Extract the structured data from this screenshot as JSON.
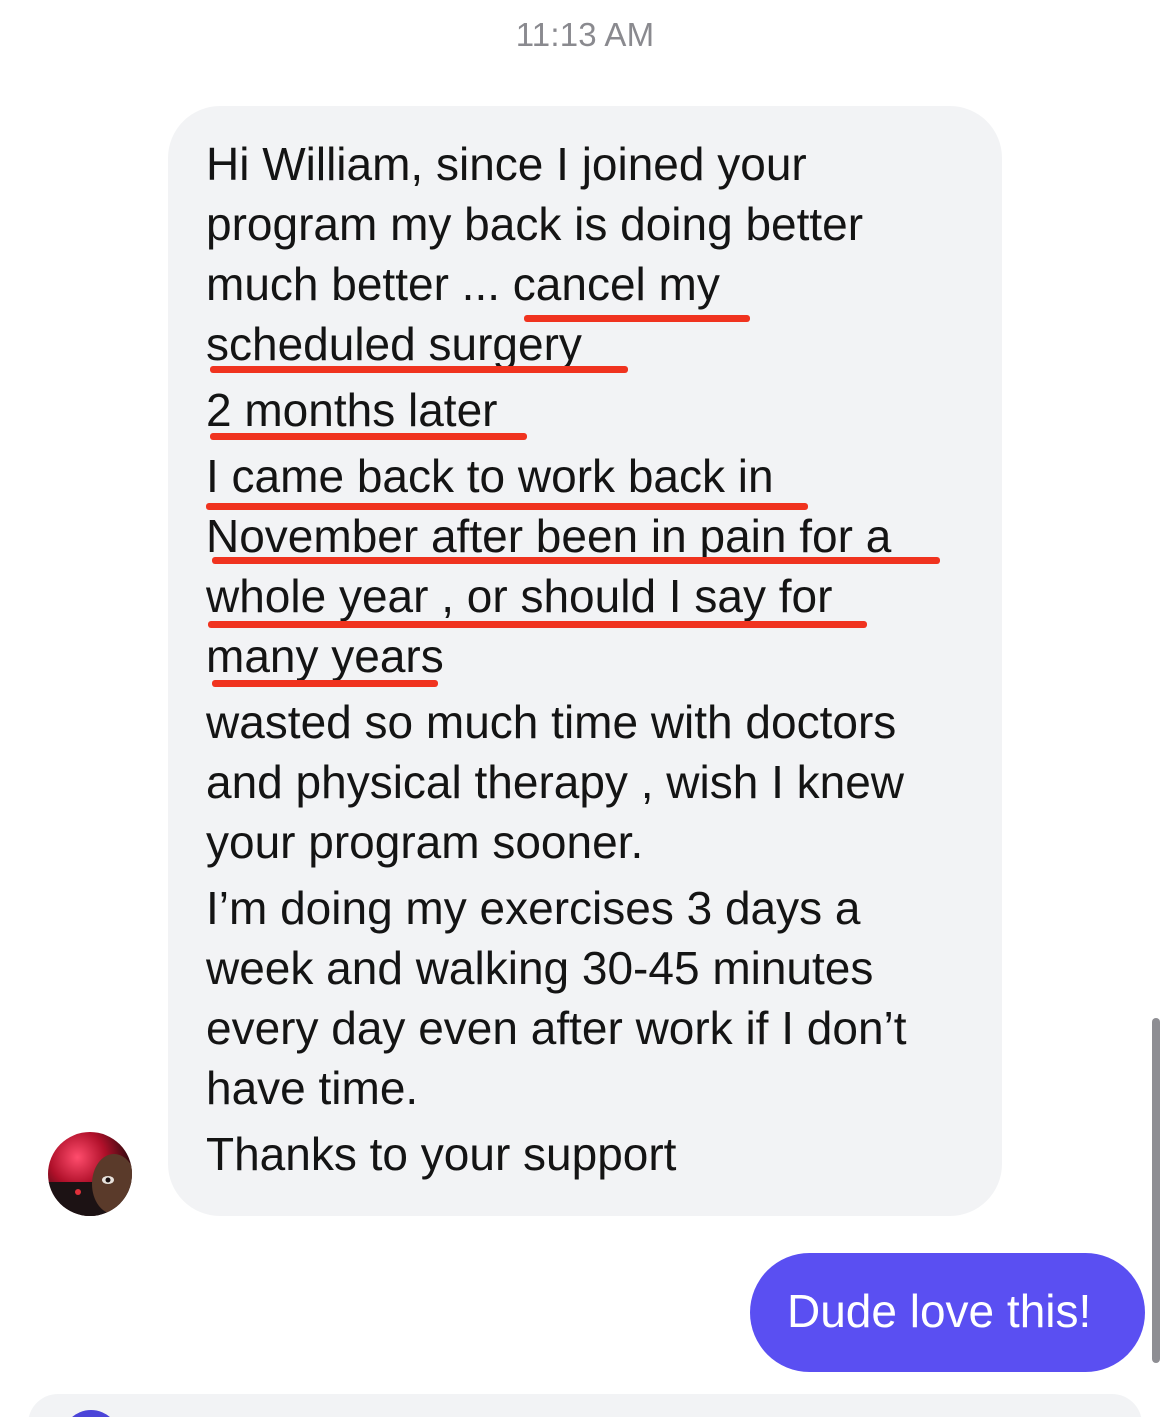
{
  "timestamp": "11:13 AM",
  "incoming_message": {
    "lines": [
      "Hi William, since I joined your",
      "program my back is doing better",
      "much better ... cancel my",
      "scheduled surgery",
      "2 months later",
      "I came back to work back in",
      "November after been in pain for a",
      "whole year , or should I say for",
      "many years",
      "wasted so much time with doctors",
      "and physical therapy , wish I knew",
      "your program sooner.",
      "I’m doing my exercises 3 days a",
      "week and walking 30-45 minutes",
      "every day even after work if I don’t",
      "have time.",
      "Thanks to your support"
    ]
  },
  "outgoing_message": {
    "text": "Dude love this!"
  },
  "colors": {
    "incoming_bubble": "#f2f3f5",
    "outgoing_bubble": "#5a4ff2",
    "underline_annotation": "#f0331f",
    "timestamp_text": "#8a8a8f"
  }
}
